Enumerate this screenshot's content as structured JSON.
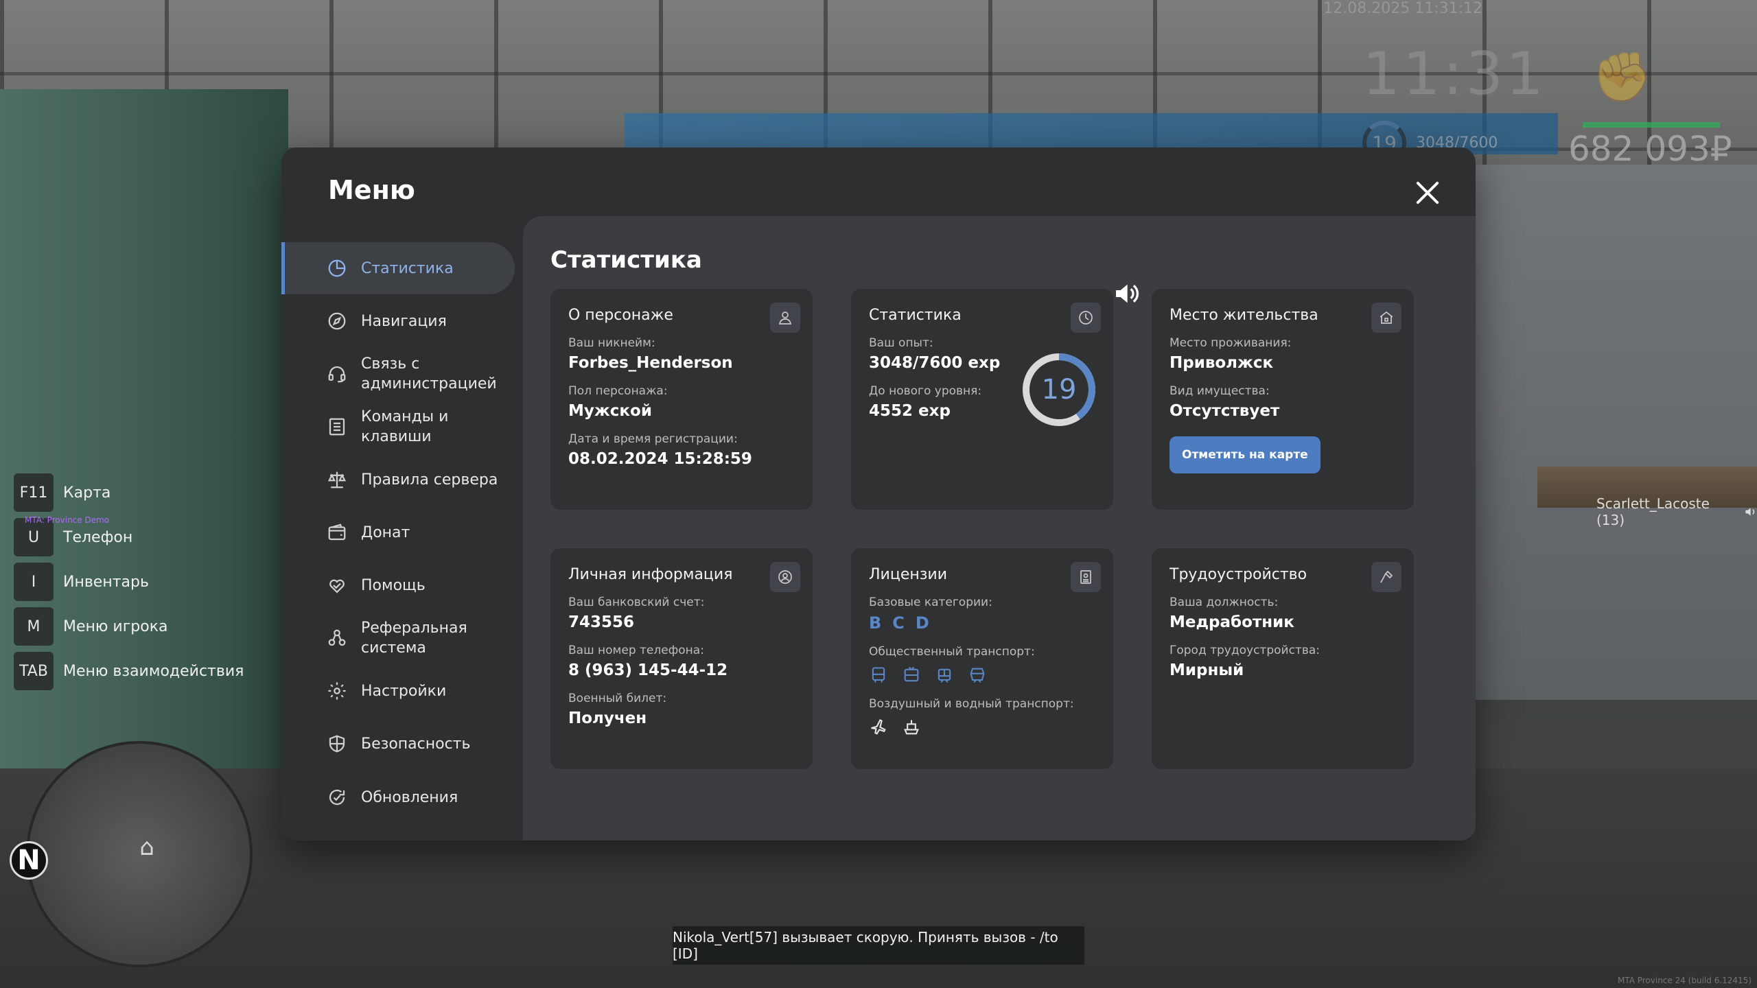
{
  "hud": {
    "date": "12.08.2025 11:31:12",
    "time": "11:31",
    "level": "19",
    "exp": "3048/7600",
    "money": "682 093₽",
    "player_tag": "Scarlett_Lacoste (13)",
    "build": "MTA Province 24 (build 6.12415)"
  },
  "keybinds": [
    {
      "key": "F11",
      "label": "Карта"
    },
    {
      "key": "U",
      "label": "Телефон"
    },
    {
      "key": "I",
      "label": "Инвентарь"
    },
    {
      "key": "M",
      "label": "Меню игрока"
    },
    {
      "key": "TAB",
      "label": "Меню взаимодействия"
    }
  ],
  "mta_tag": "MTA: Province Demo",
  "minimap": {
    "north": "N"
  },
  "chat_notice": "Nikola_Vert[57] вызывает скорую. Принять вызов - /to [ID]",
  "menu": {
    "title": "Меню",
    "sidebar": [
      {
        "label": "Статистика",
        "icon": "pie-chart-icon",
        "active": true
      },
      {
        "label": "Навигация",
        "icon": "compass-icon"
      },
      {
        "label": "Связь с администрацией",
        "icon": "headset-icon"
      },
      {
        "label": "Команды и клавиши",
        "icon": "list-icon"
      },
      {
        "label": "Правила сервера",
        "icon": "scales-icon"
      },
      {
        "label": "Донат",
        "icon": "wallet-icon"
      },
      {
        "label": "Помощь",
        "icon": "heart-hands-icon"
      },
      {
        "label": "Реферальная система",
        "icon": "referral-icon"
      },
      {
        "label": "Настройки",
        "icon": "gear-icon"
      },
      {
        "label": "Безопасность",
        "icon": "shield-icon"
      },
      {
        "label": "Обновления",
        "icon": "refresh-check-icon"
      }
    ],
    "content_title": "Статистика",
    "cards": {
      "character": {
        "title": "О персонаже",
        "nick_label": "Ваш никнейм:",
        "nick": "Forbes_Henderson",
        "gender_label": "Пол персонажа:",
        "gender": "Мужской",
        "reg_label": "Дата и время регистрации:",
        "reg": "08.02.2024 15:28:59"
      },
      "stats": {
        "title": "Статистика",
        "exp_label": "Ваш опыт:",
        "exp": "3048/7600 exp",
        "next_label": "До нового уровня:",
        "next": "4552 exp",
        "level": "19",
        "progress": 0.401
      },
      "residence": {
        "title": "Место жительства",
        "place_label": "Место проживания:",
        "place": "Приволжск",
        "property_label": "Вид имущества:",
        "property": "Отсутствует",
        "map_button": "Отметить на карте"
      },
      "personal": {
        "title": "Личная информация",
        "bank_label": "Ваш банковский счет:",
        "bank": "743556",
        "phone_label": "Ваш номер телефона:",
        "phone": "8 (963) 145-44-12",
        "military_label": "Военный билет:",
        "military": "Получен"
      },
      "licenses": {
        "title": "Лицензии",
        "base_label": "Базовые категории:",
        "base": [
          "B",
          "C",
          "D"
        ],
        "public_label": "Общественный транспорт:",
        "air_label": "Воздушный и водный транспорт:"
      },
      "employment": {
        "title": "Трудоустройство",
        "job_label": "Ваша должность:",
        "job": "Медработник",
        "city_label": "Город трудоустройства:",
        "city": "Мирный"
      }
    }
  },
  "colors": {
    "accent": "#5a86c5",
    "panel": "#2d2f31",
    "content": "#3b3d40",
    "card": "#2f3133"
  }
}
